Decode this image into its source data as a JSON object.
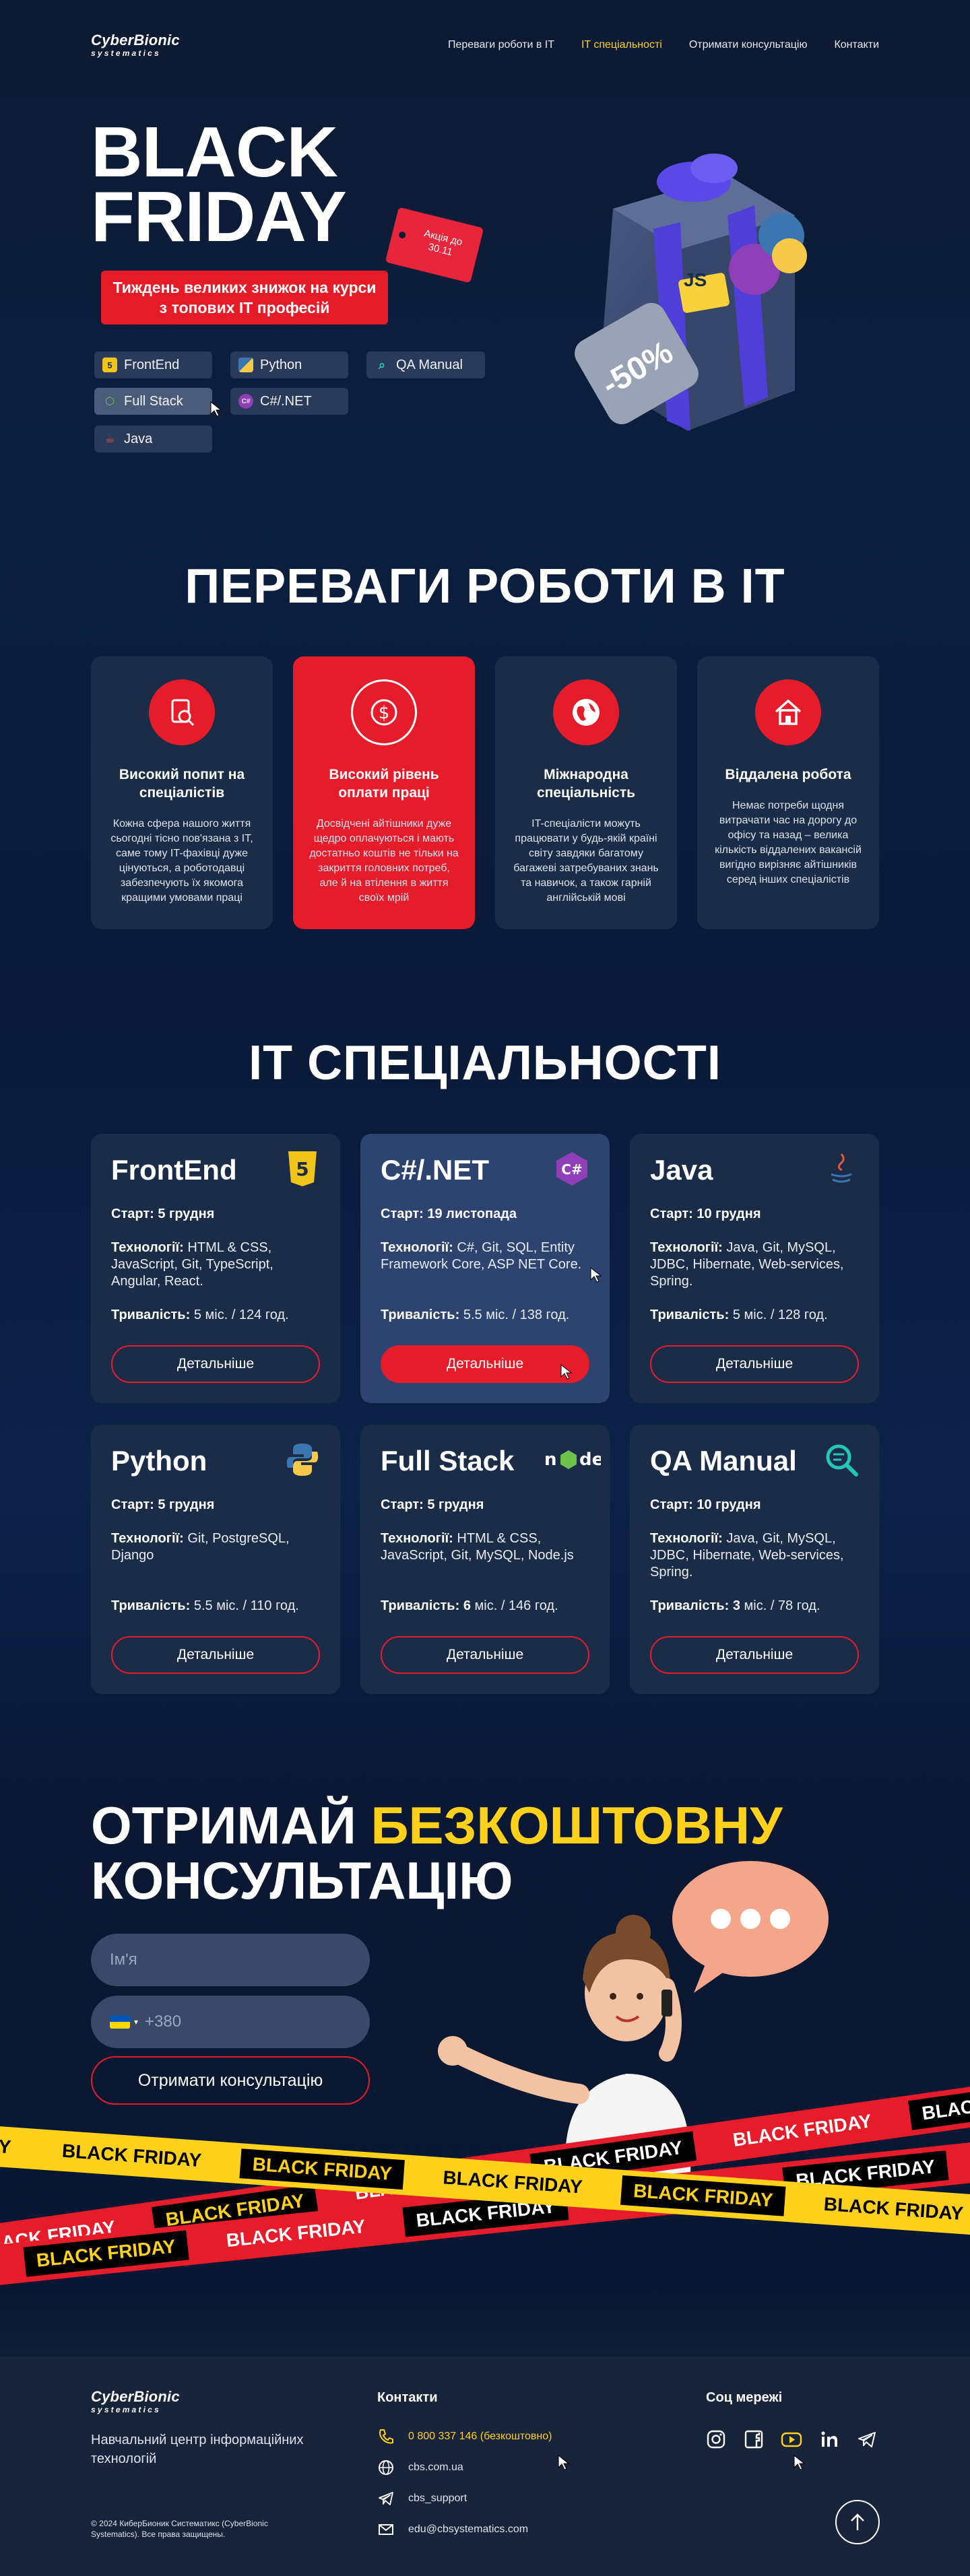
{
  "header": {
    "logo_main": "CyberBionic",
    "logo_sub": "systematics",
    "nav": [
      {
        "label": "Переваги роботи в IT",
        "active": false
      },
      {
        "label": "IT спеціальності",
        "active": true
      },
      {
        "label": "Отримати консультацію",
        "active": false
      },
      {
        "label": "Контакти",
        "active": false
      }
    ]
  },
  "hero": {
    "title_line1": "BLACK",
    "title_line2": "FRIDAY",
    "tag": "Акція до 30.11",
    "banner": "Тиждень великих знижок на курси з топових IT професій",
    "discount": "-50%",
    "chips": [
      "FrontEnd",
      "Python",
      "QA Manual",
      "Full Stack",
      "C#/.NET",
      "Java"
    ]
  },
  "advantages": {
    "title": "ПЕРЕВАГИ РОБОТИ В IT",
    "items": [
      {
        "title": "Високий попит на спеціалістів",
        "text": "Кожна сфера нашого життя сьогодні тісно пов'язана з IT, саме тому IT-фахівці дуже цінуються, а роботодавці забезпечують їх якомога кращими умовами праці",
        "icon": "search-document-icon"
      },
      {
        "title": "Високий рівень оплати праці",
        "text": "Досвідчені айтішники дуже щедро оплачуються і мають достатньо коштів не тільки на закриття головних потреб, але й на втілення в життя своїх мрій",
        "icon": "dollar-icon"
      },
      {
        "title": "Міжнародна спеціальність",
        "text": "IT-спеціалісти можуть працювати у будь-якій країні світу завдяки багатому багажеві затребуваних знань та навичок, а також гарній англійській мові",
        "icon": "globe-icon"
      },
      {
        "title": "Віддалена робота",
        "text": "Немає потреби щодня витрачати час на дорогу до офісу та назад – велика кількість віддалених вакансій вигідно вирізняє айтішників серед інших спеціалістів",
        "icon": "home-icon"
      }
    ]
  },
  "specialties": {
    "title": "IT СПЕЦІАЛЬНОСТІ",
    "start_label": "Старт:",
    "tech_label": "Технології:",
    "dur_label": "Тривалість:",
    "button_label": "Детальніше",
    "courses": [
      {
        "name": "FrontEnd",
        "start": "5 грудня",
        "tech": "HTML & CSS, JavaScript, Git, TypeScript, Angular, React.",
        "dur_main": "5",
        "dur_rest": "міс. / 124 год.",
        "icon": "html5-icon"
      },
      {
        "name": "C#/.NET",
        "start": "19 листопада",
        "tech": "C#, Git, SQL, Entity Framework Core, ASP NET Core.",
        "dur_main": "5.5",
        "dur_rest": "міс. / 138 год.",
        "icon": "csharp-icon"
      },
      {
        "name": "Java",
        "start": "10 грудня",
        "tech": "Java, Git, MySQL, JDBC, Hibernate, Web-services, Spring.",
        "dur_main": "5",
        "dur_rest": "міс. / 128 год.",
        "icon": "java-icon"
      },
      {
        "name": "Python",
        "start": "5 грудня",
        "tech": "Git, PostgreSQL, Django",
        "dur_main": "5.5",
        "dur_rest": "міс. / 110 год.",
        "icon": "python-icon"
      },
      {
        "name": "Full Stack",
        "start": "5 грудня",
        "tech": "HTML & CSS, JavaScript, Git, MySQL, Node.js",
        "dur_main": "6",
        "dur_rest": "міс. / 146 год.",
        "icon": "nodejs-icon"
      },
      {
        "name": "QA Manual",
        "start": "10 грудня",
        "tech": "Java, Git, MySQL, JDBC, Hibernate, Web-services, Spring.",
        "dur_main": "3",
        "dur_rest": "міс. / 78 год.",
        "icon": "qa-search-icon"
      }
    ]
  },
  "consultation": {
    "title_part1": "ОТРИМАЙ",
    "title_part2": "БЕЗКОШТОВНУ",
    "title_line2": "КОНСУЛЬТАЦІЮ",
    "name_placeholder": "Ім'я",
    "phone_placeholder": "+380",
    "submit_label": "Отримати консультацію",
    "tape_text": "BLACK FRIDAY",
    "tape_partial": "DAY"
  },
  "footer": {
    "logo_main": "CyberBionic",
    "logo_sub": "systematics",
    "tagline": "Навчальний центр інформаційних технологій",
    "copyright": "© 2024 КиберБионик Систематикс (CyberBionic Systematics). Все права защищены.",
    "contacts_title": "Контакти",
    "phone": "0 800 337 146 (безкоштовно)",
    "site": "cbs.com.ua",
    "telegram": "cbs_support",
    "email": "edu@cbsystematics.com",
    "social_title": "Соц мережі"
  },
  "colors": {
    "accent_red": "#e61c2a",
    "accent_yellow": "#ffd11a",
    "card_bg": "#1b2c49"
  }
}
